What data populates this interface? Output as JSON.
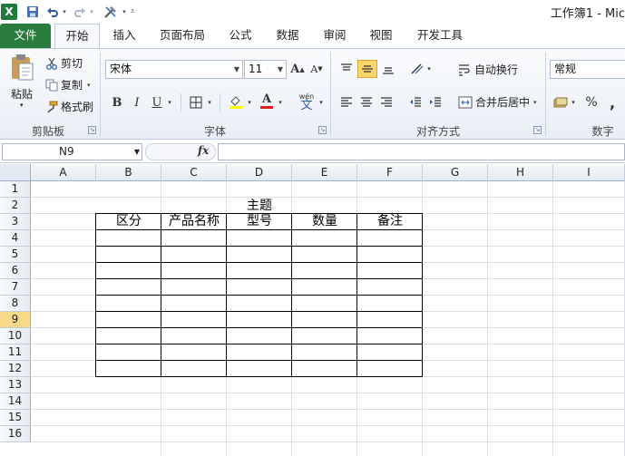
{
  "window": {
    "title": "工作簿1 - Mic"
  },
  "quick_access": {
    "app_icon": "X",
    "save_icon": "save-icon",
    "undo_icon": "undo-icon",
    "redo_icon": "redo-icon",
    "customize_icon": "customize-icon"
  },
  "tabs": [
    {
      "label": "文件"
    },
    {
      "label": "开始"
    },
    {
      "label": "插入"
    },
    {
      "label": "页面布局"
    },
    {
      "label": "公式"
    },
    {
      "label": "数据"
    },
    {
      "label": "审阅"
    },
    {
      "label": "视图"
    },
    {
      "label": "开发工具"
    }
  ],
  "ribbon": {
    "clipboard": {
      "paste": "粘贴",
      "cut": "剪切",
      "copy": "复制",
      "format_painter": "格式刷",
      "group": "剪贴板"
    },
    "font": {
      "font_name": "宋体",
      "font_size": "11",
      "bold": "B",
      "italic": "I",
      "underline": "U",
      "group": "字体",
      "grow": "A",
      "shrink": "A",
      "font_color": "A",
      "phonetic_top": "wén",
      "phonetic": "文"
    },
    "alignment": {
      "wrap_text": "自动换行",
      "merge_center": "合并后居中",
      "group": "对齐方式"
    },
    "number": {
      "format": "常规",
      "percent": "%",
      "comma": ",",
      "group": "数字"
    }
  },
  "formula_bar": {
    "name_box": "N9",
    "fx": "fx",
    "content": ""
  },
  "sheet": {
    "columns": [
      "A",
      "B",
      "C",
      "D",
      "E",
      "F",
      "G",
      "H",
      "I"
    ],
    "rows": [
      "1",
      "2",
      "3",
      "4",
      "5",
      "6",
      "7",
      "8",
      "9",
      "10",
      "11",
      "12",
      "13",
      "14",
      "15",
      "16"
    ],
    "selected_row": "9",
    "title_cell": "主题",
    "headers": [
      "区分",
      "产品名称",
      "型号",
      "数量",
      "备注"
    ]
  },
  "colors": {
    "file_tab": "#2a7c3f",
    "selection": "#f8d98a",
    "ribbon_border": "#b9c9de"
  }
}
